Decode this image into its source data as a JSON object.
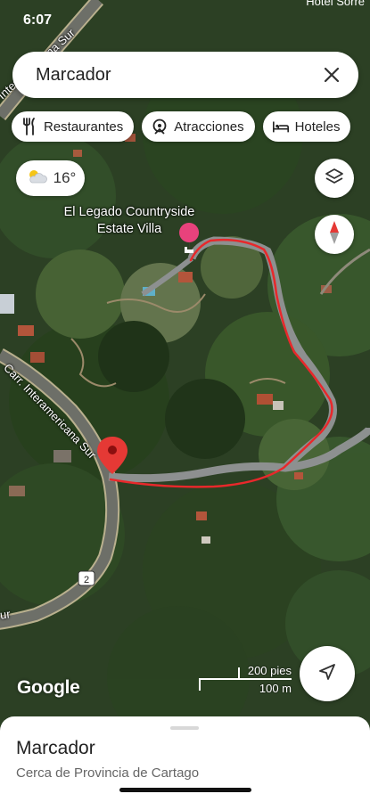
{
  "status": {
    "time": "6:07",
    "right": "Hotel Sorre"
  },
  "search": {
    "query": "Marcador"
  },
  "chips": [
    {
      "label": "Restaurantes",
      "icon": "fork-knife-icon"
    },
    {
      "label": "Atracciones",
      "icon": "attractions-icon"
    },
    {
      "label": "Hoteles",
      "icon": "bed-icon"
    }
  ],
  "weather": {
    "temp": "16°",
    "icon": "partly-cloudy-icon"
  },
  "map": {
    "place_label_line1": "El Legado Countryside",
    "place_label_line2": "Estate Villa",
    "roads": {
      "interamericana_top": "c Interamericana Sur",
      "interamericana_mid": "Carr. Interamericana Sur",
      "interamericana_bottom": "ur",
      "route_shield": "2"
    },
    "route_color": "#e8282b",
    "pin_color": "#e53935",
    "hotel_pin_color": "#e8427c"
  },
  "brand": {
    "logo": "Google"
  },
  "scale": {
    "imperial": "200 pies",
    "metric": "100 m"
  },
  "sheet": {
    "title": "Marcador",
    "subtitle": "Cerca de Provincia de Cartago"
  }
}
